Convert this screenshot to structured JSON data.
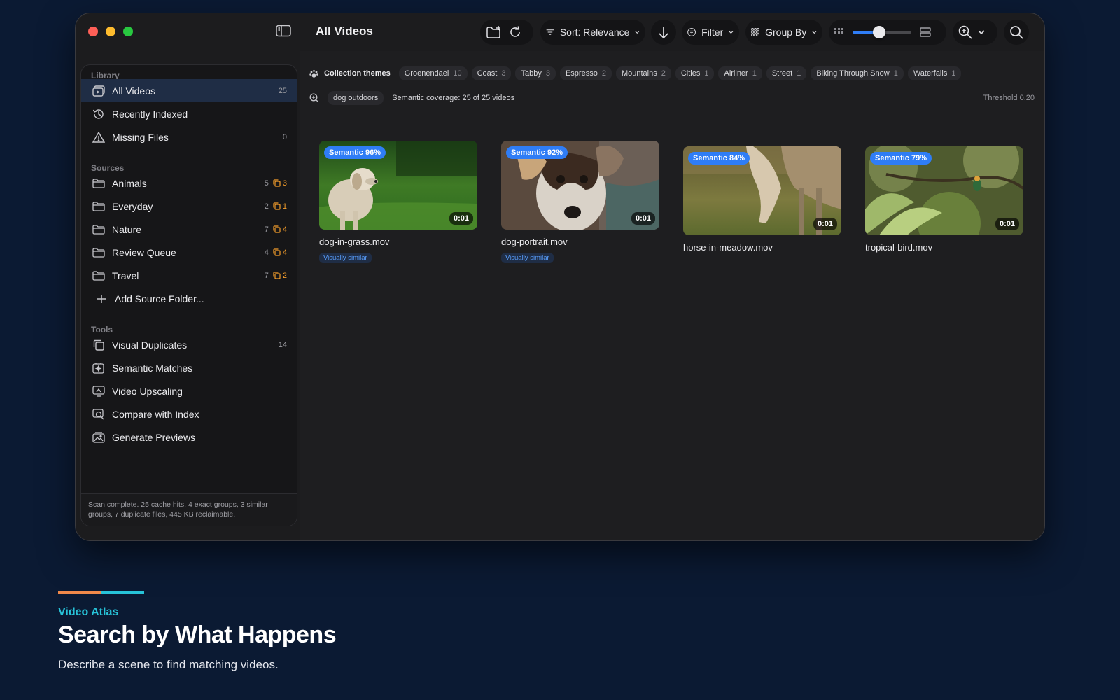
{
  "window": {
    "title": "All Videos"
  },
  "toolbar": {
    "sort_label": "Sort: Relevance",
    "filter_label": "Filter",
    "group_label": "Group By",
    "thumbnail_size_level": 0.45
  },
  "sidebar": {
    "library_label": "Library",
    "library_items": [
      {
        "label": "All Videos",
        "count": "25",
        "icon": "videos-icon"
      },
      {
        "label": "Recently Indexed",
        "count": "",
        "icon": "history-icon"
      },
      {
        "label": "Missing Files",
        "count": "0",
        "icon": "warning-icon"
      }
    ],
    "sources_label": "Sources",
    "source_items": [
      {
        "label": "Animals",
        "count": "5",
        "dups": "3"
      },
      {
        "label": "Everyday",
        "count": "2",
        "dups": "1"
      },
      {
        "label": "Nature",
        "count": "7",
        "dups": "4"
      },
      {
        "label": "Review Queue",
        "count": "4",
        "dups": "4"
      },
      {
        "label": "Travel",
        "count": "7",
        "dups": "2"
      }
    ],
    "add_source_label": "Add Source Folder...",
    "tools_label": "Tools",
    "tool_items": [
      {
        "label": "Visual Duplicates",
        "count": "14",
        "icon": "duplicates-icon"
      },
      {
        "label": "Semantic Matches",
        "count": "",
        "icon": "semantic-icon"
      },
      {
        "label": "Video Upscaling",
        "count": "",
        "icon": "upscale-icon"
      },
      {
        "label": "Compare with Index",
        "count": "",
        "icon": "compare-icon"
      },
      {
        "label": "Generate Previews",
        "count": "",
        "icon": "previews-icon"
      }
    ],
    "status_text": "Scan complete. 25 cache hits, 4 exact groups, 3 similar groups, 7 duplicate files, 445 KB reclaimable."
  },
  "themes": {
    "label": "Collection themes",
    "chips": [
      {
        "name": "Groenendael",
        "count": "10"
      },
      {
        "name": "Coast",
        "count": "3"
      },
      {
        "name": "Tabby",
        "count": "3"
      },
      {
        "name": "Espresso",
        "count": "2"
      },
      {
        "name": "Mountains",
        "count": "2"
      },
      {
        "name": "Cities",
        "count": "1"
      },
      {
        "name": "Airliner",
        "count": "1"
      },
      {
        "name": "Street",
        "count": "1"
      },
      {
        "name": "Biking Through Snow",
        "count": "1"
      },
      {
        "name": "Waterfalls",
        "count": "1"
      }
    ]
  },
  "query": {
    "text": "dog outdoors",
    "coverage": "Semantic coverage: 25 of 25 videos",
    "threshold": "Threshold 0.20"
  },
  "videos": [
    {
      "name": "dog-in-grass.mov",
      "badge": "Semantic 96%",
      "duration": "0:01",
      "tag": "Visually similar"
    },
    {
      "name": "dog-portrait.mov",
      "badge": "Semantic 92%",
      "duration": "0:01",
      "tag": "Visually similar"
    },
    {
      "name": "horse-in-meadow.mov",
      "badge": "Semantic 84%",
      "duration": "0:01",
      "tag": ""
    },
    {
      "name": "tropical-bird.mov",
      "badge": "Semantic 79%",
      "duration": "0:01",
      "tag": ""
    }
  ],
  "promo": {
    "brand": "Video Atlas",
    "headline": "Search by What Happens",
    "subline": "Describe a scene to find matching videos."
  },
  "colors": {
    "background": "#0b1a33",
    "accent": "#2f7df6",
    "duplicate": "#f59e2b",
    "brand_cyan": "#27c3d8",
    "brand_orange": "#f0894a"
  }
}
